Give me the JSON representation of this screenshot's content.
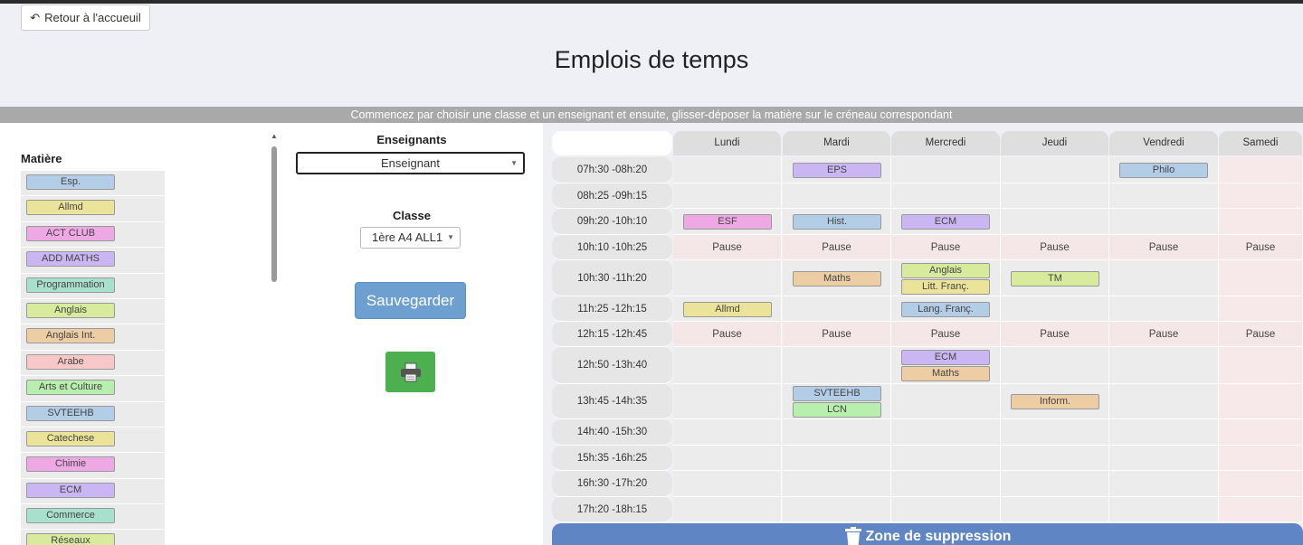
{
  "nav": {
    "back_label": "Retour à l'accueuil"
  },
  "page": {
    "title": "Emplois de temps",
    "instruction": "Commencez par choisir une classe et un enseignant et ensuite, glisser-déposer la matière sur le créneau correspondant"
  },
  "subjects": {
    "title": "Matière",
    "items": [
      {
        "label": "Esp.",
        "color": "#b3cde6"
      },
      {
        "label": "Allmd",
        "color": "#ece39a"
      },
      {
        "label": "ACT CLUB",
        "color": "#eea8e4"
      },
      {
        "label": "ADD MATHS",
        "color": "#c9b6f2"
      },
      {
        "label": "Programmation",
        "color": "#a7e0cc"
      },
      {
        "label": "Anglais",
        "color": "#d8eb9c"
      },
      {
        "label": "Anglais Int.",
        "color": "#eccda4"
      },
      {
        "label": "Arabe",
        "color": "#f8c8c8"
      },
      {
        "label": "Arts et Culture",
        "color": "#b8eeae"
      },
      {
        "label": "SVTEEHB",
        "color": "#b3cde6"
      },
      {
        "label": "Catechese",
        "color": "#ece39a"
      },
      {
        "label": "Chimie",
        "color": "#eea8e4"
      },
      {
        "label": "ECM",
        "color": "#c9b6f2"
      },
      {
        "label": "Commerce",
        "color": "#a7e0cc"
      },
      {
        "label": "Réseaux",
        "color": "#d8eb9c"
      }
    ]
  },
  "controls": {
    "teachers_label": "Enseignants",
    "teacher_selected": "Enseignant",
    "class_label": "Classe",
    "class_selected": "1ère A4 ALL1",
    "save_label": "Sauvegarder"
  },
  "timetable": {
    "days": [
      "Lundi",
      "Mardi",
      "Mercredi",
      "Jeudi",
      "Vendredi",
      "Samedi"
    ],
    "pause_label": "Pause",
    "slots": [
      {
        "time": "07h:30 -08h:20",
        "pause": false,
        "entries": [
          {
            "day": 1,
            "chips": [
              {
                "label": "EPS",
                "color": "#c9b6f2"
              }
            ]
          },
          {
            "day": 4,
            "chips": [
              {
                "label": "Philo",
                "color": "#b3cde6"
              }
            ]
          }
        ]
      },
      {
        "time": "08h:25 -09h:15",
        "pause": false,
        "entries": []
      },
      {
        "time": "09h:20 -10h:10",
        "pause": false,
        "entries": [
          {
            "day": 0,
            "chips": [
              {
                "label": "ESF",
                "color": "#eea8e4"
              }
            ]
          },
          {
            "day": 1,
            "chips": [
              {
                "label": "Hist.",
                "color": "#b3cde6"
              }
            ]
          },
          {
            "day": 2,
            "chips": [
              {
                "label": "ECM",
                "color": "#c9b6f2"
              }
            ]
          }
        ]
      },
      {
        "time": "10h:10 -10h:25",
        "pause": true,
        "entries": []
      },
      {
        "time": "10h:30 -11h:20",
        "pause": false,
        "entries": [
          {
            "day": 1,
            "chips": [
              {
                "label": "Maths",
                "color": "#eccda4"
              }
            ]
          },
          {
            "day": 2,
            "chips": [
              {
                "label": "Anglais",
                "color": "#d8eb9c"
              },
              {
                "label": "Litt. Franç.",
                "color": "#ece39a"
              }
            ]
          },
          {
            "day": 3,
            "chips": [
              {
                "label": "TM",
                "color": "#d8eb9c"
              }
            ]
          }
        ]
      },
      {
        "time": "11h:25 -12h:15",
        "pause": false,
        "entries": [
          {
            "day": 0,
            "chips": [
              {
                "label": "Allmd",
                "color": "#ece39a"
              }
            ]
          },
          {
            "day": 2,
            "chips": [
              {
                "label": "Lang. Franç.",
                "color": "#b3cde6"
              }
            ]
          }
        ]
      },
      {
        "time": "12h:15 -12h:45",
        "pause": true,
        "entries": []
      },
      {
        "time": "12h:50 -13h:40",
        "pause": false,
        "entries": [
          {
            "day": 2,
            "chips": [
              {
                "label": "ECM",
                "color": "#c9b6f2"
              },
              {
                "label": "Maths",
                "color": "#eccda4"
              }
            ]
          }
        ]
      },
      {
        "time": "13h:45 -14h:35",
        "pause": false,
        "entries": [
          {
            "day": 1,
            "chips": [
              {
                "label": "SVTEEHB",
                "color": "#b3cde6"
              },
              {
                "label": "LCN",
                "color": "#b8eeae"
              }
            ]
          },
          {
            "day": 3,
            "chips": [
              {
                "label": "Inform.",
                "color": "#eccda4"
              }
            ]
          }
        ]
      },
      {
        "time": "14h:40 -15h:30",
        "pause": false,
        "entries": []
      },
      {
        "time": "15h:35 -16h:25",
        "pause": false,
        "entries": []
      },
      {
        "time": "16h:30 -17h:20",
        "pause": false,
        "entries": []
      },
      {
        "time": "17h:20 -18h:15",
        "pause": false,
        "entries": []
      }
    ]
  },
  "delete_zone": {
    "label": "Zone de suppression",
    "icon": "trash-icon"
  }
}
